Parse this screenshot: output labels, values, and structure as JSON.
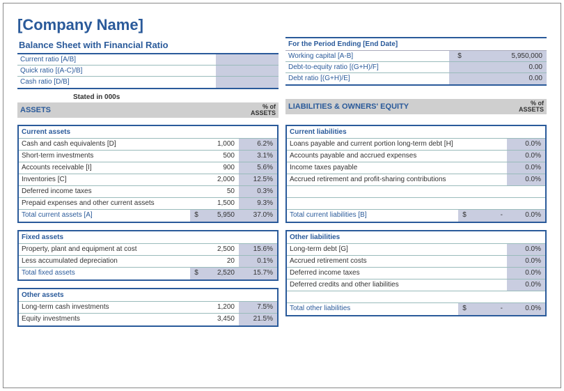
{
  "company_name": "[Company Name]",
  "left": {
    "subtitle": "Balance Sheet with Financial Ratio",
    "ratios": [
      {
        "label": "Current ratio [A/B]",
        "value": ""
      },
      {
        "label": "Quick ratio [(A-C)/B]",
        "value": ""
      },
      {
        "label": "Cash ratio [D/B]",
        "value": ""
      }
    ],
    "stated": "Stated in 000s",
    "section_title": "ASSETS",
    "section_pct_label": "% of ASSETS",
    "tables": [
      {
        "head": "Current assets",
        "rows": [
          {
            "label": "Cash and cash equivalents [D]",
            "value": "1,000",
            "pct": "6.2%"
          },
          {
            "label": "Short-term investments",
            "value": "500",
            "pct": "3.1%"
          },
          {
            "label": "Accounts receivable [I]",
            "value": "900",
            "pct": "5.6%"
          },
          {
            "label": "Inventories [C]",
            "value": "2,000",
            "pct": "12.5%"
          },
          {
            "label": "Deferred income taxes",
            "value": "50",
            "pct": "0.3%"
          },
          {
            "label": "Prepaid expenses and other current assets",
            "value": "1,500",
            "pct": "9.3%"
          }
        ],
        "total": {
          "label": "Total current assets [A]",
          "currency": "$",
          "value": "5,950",
          "pct": "37.0%"
        }
      },
      {
        "head": "Fixed assets",
        "rows": [
          {
            "label": "Property, plant and equipment at cost",
            "value": "2,500",
            "pct": "15.6%"
          },
          {
            "label": "Less accumulated depreciation",
            "value": "20",
            "pct": "0.1%"
          }
        ],
        "total": {
          "label": "Total fixed assets",
          "currency": "$",
          "value": "2,520",
          "pct": "15.7%"
        }
      },
      {
        "head": "Other assets",
        "rows": [
          {
            "label": "Long-term cash investments",
            "value": "1,200",
            "pct": "7.5%"
          },
          {
            "label": "Equity investments",
            "value": "3,450",
            "pct": "21.5%"
          }
        ]
      }
    ]
  },
  "right": {
    "period_header": "For the Period Ending [End Date]",
    "metrics": [
      {
        "label": "Working capital [A-B]",
        "currency": "$",
        "value": "5,950,000"
      },
      {
        "label": "Debt-to-equity ratio [(G+H)/F]",
        "currency": "",
        "value": "0.00"
      },
      {
        "label": "Debt ratio [(G+H)/E]",
        "currency": "",
        "value": "0.00"
      }
    ],
    "section_title": "LIABILITIES & OWNERS' EQUITY",
    "section_pct_label": "% of ASSETS",
    "tables": [
      {
        "head": "Current liabilities",
        "rows": [
          {
            "label": "Loans payable and current portion long-term debt [H]",
            "value": "",
            "pct": "0.0%"
          },
          {
            "label": "Accounts payable and accrued expenses",
            "value": "",
            "pct": "0.0%"
          },
          {
            "label": "Income taxes payable",
            "value": "",
            "pct": "0.0%"
          },
          {
            "label": "Accrued retirement and profit-sharing contributions",
            "value": "",
            "pct": "0.0%"
          }
        ],
        "total": {
          "label": "Total current liabilities [B]",
          "currency": "$",
          "value": "-",
          "pct": "0.0%"
        }
      },
      {
        "head": "Other liabilities",
        "rows": [
          {
            "label": "Long-term debt [G]",
            "value": "",
            "pct": "0.0%"
          },
          {
            "label": "Accrued retirement costs",
            "value": "",
            "pct": "0.0%"
          },
          {
            "label": "Deferred income taxes",
            "value": "",
            "pct": "0.0%"
          },
          {
            "label": "Deferred credits and other liabilities",
            "value": "",
            "pct": "0.0%"
          }
        ],
        "total": {
          "label": "Total other liabilities",
          "currency": "$",
          "value": "-",
          "pct": "0.0%"
        }
      }
    ]
  }
}
